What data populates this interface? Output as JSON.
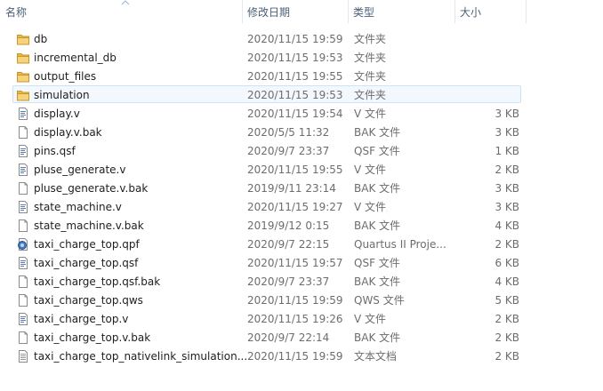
{
  "columns": {
    "name": "名称",
    "modified": "修改日期",
    "type": "类型",
    "size": "大小"
  },
  "files": [
    {
      "name": "db",
      "date": "2020/11/15 19:59",
      "type": "文件夹",
      "size": "",
      "icon": "folder-icon",
      "selected": false
    },
    {
      "name": "incremental_db",
      "date": "2020/11/15 19:53",
      "type": "文件夹",
      "size": "",
      "icon": "folder-icon",
      "selected": false
    },
    {
      "name": "output_files",
      "date": "2020/11/15 19:55",
      "type": "文件夹",
      "size": "",
      "icon": "folder-icon",
      "selected": false
    },
    {
      "name": "simulation",
      "date": "2020/11/15 19:53",
      "type": "文件夹",
      "size": "",
      "icon": "folder-icon",
      "selected": true
    },
    {
      "name": "display.v",
      "date": "2020/11/15 19:54",
      "type": "V 文件",
      "size": "3 KB",
      "icon": "code-file-icon",
      "selected": false
    },
    {
      "name": "display.v.bak",
      "date": "2020/5/5 11:32",
      "type": "BAK 文件",
      "size": "3 KB",
      "icon": "file-icon",
      "selected": false
    },
    {
      "name": "pins.qsf",
      "date": "2020/9/7 23:37",
      "type": "QSF 文件",
      "size": "1 KB",
      "icon": "code-file-icon",
      "selected": false
    },
    {
      "name": "pluse_generate.v",
      "date": "2020/11/15 19:55",
      "type": "V 文件",
      "size": "2 KB",
      "icon": "code-file-icon",
      "selected": false
    },
    {
      "name": "pluse_generate.v.bak",
      "date": "2019/9/11 23:14",
      "type": "BAK 文件",
      "size": "3 KB",
      "icon": "file-icon",
      "selected": false
    },
    {
      "name": "state_machine.v",
      "date": "2020/11/15 19:27",
      "type": "V 文件",
      "size": "3 KB",
      "icon": "code-file-icon",
      "selected": false
    },
    {
      "name": "state_machine.v.bak",
      "date": "2019/9/12 0:15",
      "type": "BAK 文件",
      "size": "4 KB",
      "icon": "file-icon",
      "selected": false
    },
    {
      "name": "taxi_charge_top.qpf",
      "date": "2020/9/7 22:15",
      "type": "Quartus II Proje...",
      "size": "2 KB",
      "icon": "quartus-project-icon",
      "selected": false
    },
    {
      "name": "taxi_charge_top.qsf",
      "date": "2020/11/15 19:57",
      "type": "QSF 文件",
      "size": "6 KB",
      "icon": "code-file-icon",
      "selected": false
    },
    {
      "name": "taxi_charge_top.qsf.bak",
      "date": "2020/9/7 23:37",
      "type": "BAK 文件",
      "size": "4 KB",
      "icon": "file-icon",
      "selected": false
    },
    {
      "name": "taxi_charge_top.qws",
      "date": "2020/11/15 19:59",
      "type": "QWS 文件",
      "size": "5 KB",
      "icon": "file-icon",
      "selected": false
    },
    {
      "name": "taxi_charge_top.v",
      "date": "2020/11/15 19:26",
      "type": "V 文件",
      "size": "2 KB",
      "icon": "code-file-icon",
      "selected": false
    },
    {
      "name": "taxi_charge_top.v.bak",
      "date": "2020/9/7 22:14",
      "type": "BAK 文件",
      "size": "2 KB",
      "icon": "file-icon",
      "selected": false
    },
    {
      "name": "taxi_charge_top_nativelink_simulation....",
      "date": "2020/11/15 19:59",
      "type": "文本文档",
      "size": "2 KB",
      "icon": "text-file-icon",
      "selected": false
    }
  ]
}
